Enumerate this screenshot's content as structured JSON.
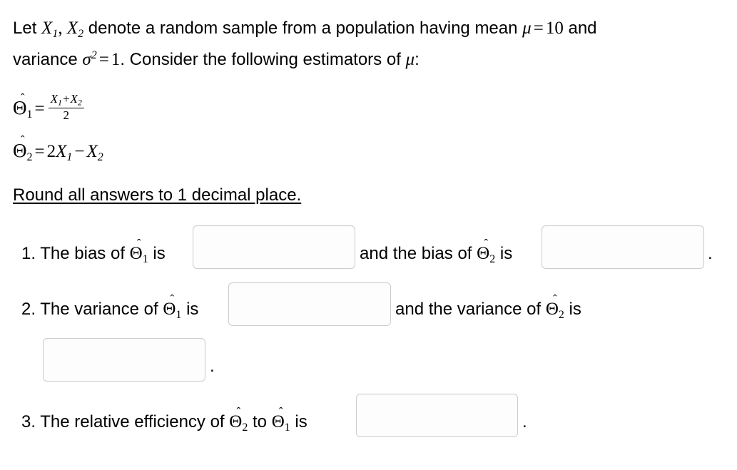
{
  "problem": {
    "line1_prefix": "Let ",
    "var1": "X",
    "var1_sub": "1",
    "comma": ", ",
    "var2": "X",
    "var2_sub": "2",
    "line1_mid": " denote a random sample from a population having mean ",
    "mu": "μ",
    "equals": "=",
    "mean_value": "10",
    "line1_suffix": " and",
    "line2_prefix": "variance ",
    "sigma": "σ",
    "sigma_sup": "2",
    "variance_value": "1",
    "line2_suffix": ". Consider the following estimators of ",
    "line2_end": ":"
  },
  "estimators": {
    "theta_glyph": "Θ",
    "hat_glyph": "ˆ",
    "eq1": {
      "name_sub": "1",
      "equals": "=",
      "numerator_a": "X",
      "numerator_a_sub": "1",
      "plus": "+",
      "numerator_b": "X",
      "numerator_b_sub": "2",
      "denominator": "2"
    },
    "eq2": {
      "name_sub": "2",
      "equals": "=",
      "coefficient": "2",
      "term_a": "X",
      "term_a_sub": "1",
      "minus": "−",
      "term_b": "X",
      "term_b_sub": "2"
    }
  },
  "instruction": {
    "text": "Round all answers to 1 decimal place."
  },
  "questions": [
    {
      "number": "1.",
      "part_a_prefix": "1. The bias of ",
      "part_a_sub": "1",
      "part_a_suffix": " is",
      "part_b_prefix": "and the bias of ",
      "part_b_sub": "2",
      "part_b_suffix": " is",
      "trailing_period": "."
    },
    {
      "number": "2.",
      "part_a_prefix": "2. The variance of ",
      "part_a_sub": "1",
      "part_a_suffix": " is",
      "part_b_prefix": "and the variance of ",
      "part_b_sub": "2",
      "part_b_suffix": " is",
      "trailing_period": "."
    },
    {
      "number": "3.",
      "part_a_prefix": "3. The relative efficiency of ",
      "part_a_sub": "2",
      "part_a_mid": " to ",
      "part_a_sub2": "1",
      "part_a_suffix": " is",
      "trailing_period": "."
    }
  ],
  "answer_fields": [
    {
      "id": "bias-theta1",
      "value": "",
      "placeholder": ""
    },
    {
      "id": "bias-theta2",
      "value": "",
      "placeholder": ""
    },
    {
      "id": "variance-theta1",
      "value": "",
      "placeholder": ""
    },
    {
      "id": "variance-theta2",
      "value": "",
      "placeholder": ""
    },
    {
      "id": "relative-efficiency",
      "value": "",
      "placeholder": ""
    }
  ],
  "colors": {
    "background": "#ffffff",
    "text": "#000000",
    "input_border": "#cccccc",
    "input_fill": "#fdfdfd"
  }
}
